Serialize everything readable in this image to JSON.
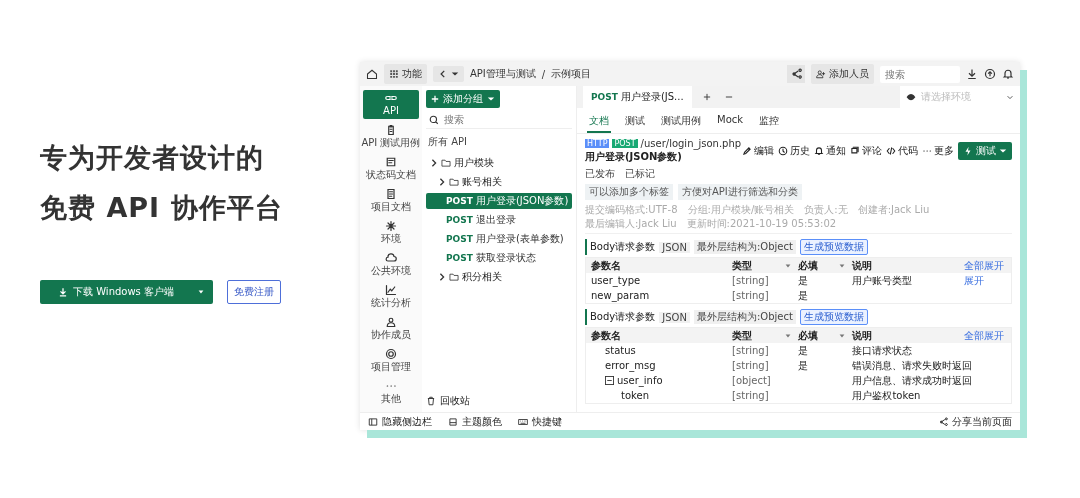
{
  "hero": {
    "title_lines": [
      "专为开发者设计的",
      "免费 API 协作平台"
    ],
    "download_button": "下载 Windows 客户端",
    "signup_button": "免费注册"
  },
  "app": {
    "topbar": {
      "menu_button": "功能",
      "breadcrumb": [
        "API管理与测试",
        "示例项目"
      ],
      "separator": "/",
      "add_member_button": "添加人员",
      "search": {
        "placeholder": "搜索"
      }
    },
    "nav": [
      {
        "label": "API",
        "selected": true
      },
      {
        "label": "API 测试用例",
        "selected": false
      },
      {
        "label": "状态码文档",
        "selected": false
      },
      {
        "label": "项目文档",
        "selected": false
      },
      {
        "label": "环境",
        "selected": false
      },
      {
        "label": "公共环境",
        "selected": false
      },
      {
        "label": "统计分析",
        "selected": false
      },
      {
        "label": "协作成员",
        "selected": false
      },
      {
        "label": "项目管理",
        "selected": false
      },
      {
        "label": "其他",
        "selected": false
      }
    ],
    "tree": {
      "add_group_button": "添加分组",
      "search": {
        "placeholder": "搜索"
      },
      "root": "所有 API",
      "items": [
        {
          "kind": "folder",
          "label": "用户模块",
          "children": [
            {
              "kind": "folder",
              "label": "账号相关",
              "children": [
                {
                  "kind": "api",
                  "method": "POST",
                  "label": "用户登录(JSON参数)",
                  "selected": true
                },
                {
                  "kind": "api",
                  "method": "POST",
                  "label": "退出登录",
                  "selected": false
                },
                {
                  "kind": "api",
                  "method": "POST",
                  "label": "用户登录(表单参数)",
                  "selected": false
                },
                {
                  "kind": "api",
                  "method": "POST",
                  "label": "获取登录状态",
                  "selected": false
                }
              ]
            },
            {
              "kind": "folder",
              "label": "积分相关"
            }
          ]
        }
      ],
      "recycle_bin": "回收站"
    },
    "tabs": [
      {
        "method": "POST",
        "label": "用户登录(JS...",
        "selected": true
      }
    ],
    "environment": {
      "placeholder": "请选择环境"
    },
    "subtabs": [
      {
        "label": "文档",
        "selected": true
      },
      {
        "label": "测试",
        "selected": false
      },
      {
        "label": "测试用例",
        "selected": false
      },
      {
        "label": "Mock",
        "selected": false
      },
      {
        "label": "监控",
        "selected": false
      }
    ],
    "api": {
      "protocol": "HTTP",
      "method": "POST",
      "path": "/user/login_json.php",
      "name": "用户登录(JSON参数)",
      "actions": [
        "编辑",
        "历史",
        "通知",
        "评论",
        "代码",
        "更多"
      ],
      "run_button": "测试",
      "statuses": [
        "已发布",
        "已标记"
      ],
      "tags": [
        "可以添加多个标签",
        "方便对API进行筛选和分类"
      ],
      "meta": [
        "提交编码格式:UTF-8",
        "分组:用户模块/账号相关",
        "负责人:无",
        "创建者:Jack Liu",
        "最后编辑人:Jack Liu",
        "更新时间:2021-10-19 05:53:02"
      ]
    },
    "sections": [
      {
        "title": "Body请求参数",
        "format": "JSON",
        "structure": "最外层结构为:Object",
        "preview_button": "生成预览数据",
        "columns": [
          "参数名",
          "类型",
          "必填",
          "说明"
        ],
        "expand_all": "全部展开",
        "rows": [
          {
            "name": "user_type",
            "type": "[string]",
            "required": "是",
            "description": "用户账号类型",
            "action": "展开"
          },
          {
            "name": "new_param",
            "type": "[string]",
            "required": "是"
          }
        ]
      },
      {
        "title": "Body请求参数",
        "format": "JSON",
        "structure": "最外层结构为:Object",
        "preview_button": "生成预览数据",
        "columns": [
          "参数名",
          "类型",
          "必填",
          "说明"
        ],
        "expand_all": "全部展开",
        "rows": [
          {
            "name": "status",
            "type": "[string]",
            "required": "是",
            "description": "接口请求状态"
          },
          {
            "name": "error_msg",
            "type": "[string]",
            "required": "是",
            "description": "错误消息、请求失败时返回"
          },
          {
            "name": "user_info",
            "type": "[object]",
            "description": "用户信息、请求成功时返回",
            "expanded": true,
            "children": [
              {
                "name": "token",
                "type": "[string]",
                "description": "用户鉴权token"
              }
            ]
          }
        ]
      }
    ],
    "footer": {
      "hide_sidebar": "隐藏侧边栏",
      "theme": "主题颜色",
      "shortcuts": "快捷键",
      "share": "分享当前页面"
    }
  }
}
